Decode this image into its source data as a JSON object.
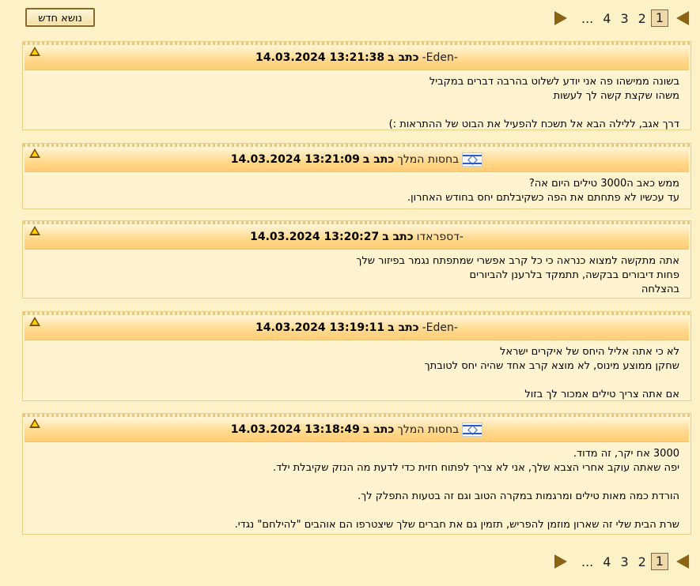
{
  "toolbar": {
    "new_topic_label": "נושא חדש"
  },
  "pagination": {
    "pages": [
      "1",
      "2",
      "3",
      "4"
    ],
    "current": "1",
    "ellipsis": "..."
  },
  "post_meta": {
    "wrote_label": "כתב ב"
  },
  "posts": [
    {
      "author": "-Eden-",
      "flag": false,
      "timestamp": "13:21:38 14.03.2024",
      "lines": [
        "בשונה ממישהו פה אני יודע לשלוט בהרבה דברים במקביל",
        "משהו שקצת קשה לך לעשות",
        "",
        "דרך אגב, ללילה הבא אל תשכח להפעיל את הבוט של ההתראות :)"
      ]
    },
    {
      "author": "בחסות המלך",
      "flag": true,
      "timestamp": "13:21:09 14.03.2024",
      "lines": [
        "ממש כאב ה3000 טילים היום אה?",
        "עד עכשיו לא פתחתם את הפה כשקיבלתם יחס בחודש האחרון."
      ]
    },
    {
      "author": "-דספראדו",
      "flag": false,
      "timestamp": "13:20:27 14.03.2024",
      "lines": [
        "אתה מתקשה למצוא כנראה כי כל קרב אפשרי שמתפתח נגמר בפיזור שלך",
        "פחות דיבורים בבקשה, תתמקד בלרענן להביורים",
        "בהצלחה"
      ]
    },
    {
      "author": "-Eden-",
      "flag": false,
      "timestamp": "13:19:11 14.03.2024",
      "lines": [
        "לא כי אתה אליל היחס של איקרים ישראל",
        "שחקן ממוצע מינוס, לא מוצא קרב אחד שהיה יחס לטובתך",
        "",
        "אם אתה צריך טילים אמכור לך בזול"
      ]
    },
    {
      "author": "בחסות המלך",
      "flag": true,
      "timestamp": "13:18:49 14.03.2024",
      "lines": [
        "3000 אח יקר, זה מדוד.",
        "יפה שאתה עוקב אחרי הצבא שלך, אני לא צריך לפתוח חזית כדי לדעת מה הנזק שקיבלת ילד.",
        "",
        "הורדת כמה מאות טילים ומרגמות במקרה הטוב וגם זה בטעות התפלק לך.",
        "",
        "שרת הבית שלי זה שארון מוזמן להפריש, תזמין גם את חברים שלך שיצטרפו הם אוהבים \"להילחם\" נגדי."
      ]
    }
  ]
}
